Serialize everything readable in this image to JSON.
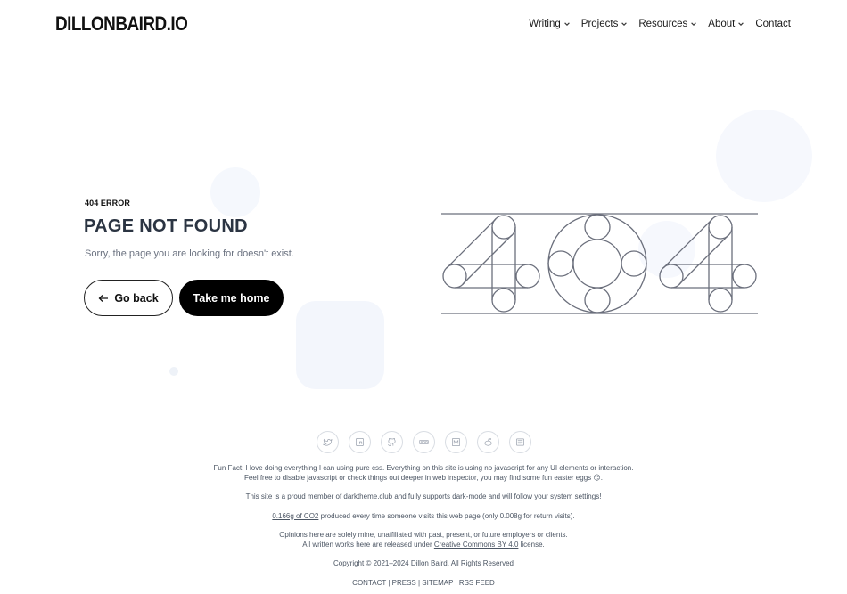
{
  "header": {
    "logo": "DILLONBAIRD.IO",
    "nav": [
      {
        "label": "Writing",
        "dropdown": true
      },
      {
        "label": "Projects",
        "dropdown": true
      },
      {
        "label": "Resources",
        "dropdown": true
      },
      {
        "label": "About",
        "dropdown": true
      },
      {
        "label": "Contact",
        "dropdown": false
      }
    ]
  },
  "error": {
    "tag": "404 ERROR",
    "title": "PAGE NOT FOUND",
    "message": "Sorry, the page you are looking for doesn't exist.",
    "back_label": "Go back",
    "home_label": "Take me home",
    "art_text": "404"
  },
  "socials": [
    "twitter-icon",
    "linkedin-icon",
    "github-icon",
    "npm-icon",
    "medium-icon",
    "reddit-icon",
    "blog-icon"
  ],
  "footer": {
    "fun_fact_1": "Fun Fact: I love doing everything I can using pure css. Everything on this site is using no javascript for any UI elements or interaction.",
    "fun_fact_2": "Feel free to disable javascript or check things out deeper in web inspector, you may find some fun easter eggs 😏.",
    "member_pre": "This site is a proud member of ",
    "member_link": "darktheme.club",
    "member_post": " and fully supports dark-mode and will follow your system settings!",
    "co2_link": "0.166g of CO2",
    "co2_post": " produced every time someone visits this web page (only 0.008g for return visits).",
    "opinions": "Opinions here are solely mine, unaffiliated with past, present, or future employers or clients.",
    "license_pre": "All written works here are released under ",
    "license_link": "Creative Commons BY 4.0",
    "license_post": " license.",
    "copyright": "Copyright © 2021–2024 Dillon Baird. All Rights Reserved",
    "links": [
      "CONTACT",
      "PRESS",
      "SITEMAP",
      "RSS FEED"
    ]
  },
  "colors": {
    "ink": "#111111",
    "title": "#2b3442",
    "muted": "#6b7280",
    "art_stroke": "#6b6f7c",
    "blob": "#f1f5fc"
  }
}
